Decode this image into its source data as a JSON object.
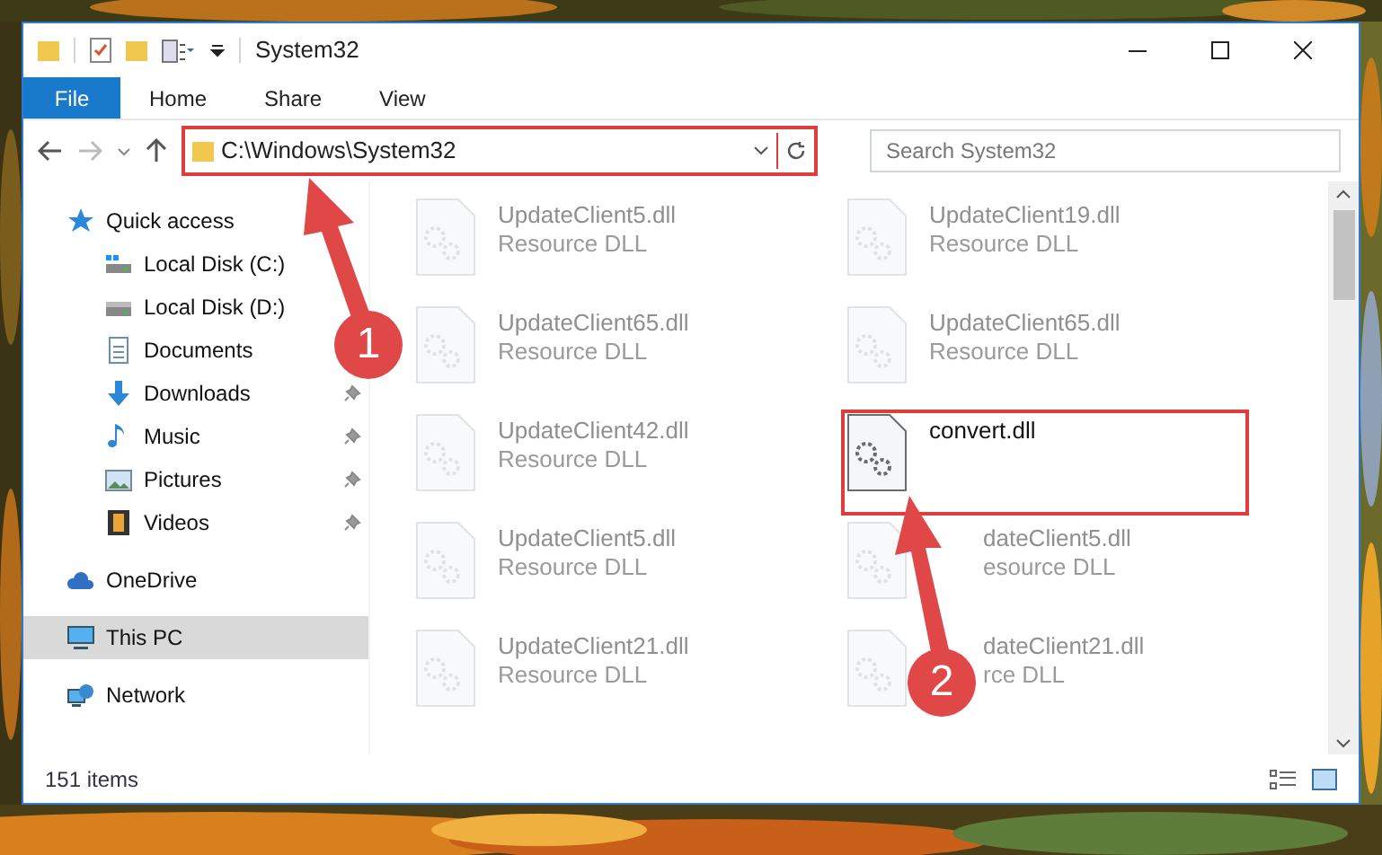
{
  "window": {
    "title": "System32"
  },
  "ribbon": {
    "file_menu": "File",
    "tabs": [
      "Home",
      "Share",
      "View"
    ]
  },
  "address": "C:\\Windows\\System32",
  "search": {
    "placeholder": "Search System32"
  },
  "sidebar": {
    "items": [
      {
        "label": "Quick access",
        "kind": "star",
        "selected": false,
        "children": [
          {
            "label": "Local Disk (C:)",
            "kind": "system-drive",
            "pinned": false
          },
          {
            "label": "Local Disk (D:)",
            "kind": "drive",
            "pinned": false
          },
          {
            "label": "Documents",
            "kind": "document",
            "pinned": false
          },
          {
            "label": "Downloads",
            "kind": "download",
            "pinned": true
          },
          {
            "label": "Music",
            "kind": "music",
            "pinned": true
          },
          {
            "label": "Pictures",
            "kind": "pictures",
            "pinned": true
          },
          {
            "label": "Videos",
            "kind": "videos",
            "pinned": true
          }
        ]
      },
      {
        "label": "OneDrive",
        "kind": "cloud",
        "selected": false
      },
      {
        "label": "This PC",
        "kind": "computer",
        "selected": true
      },
      {
        "label": "Network",
        "kind": "network",
        "selected": false
      }
    ]
  },
  "files": [
    {
      "name": "UpdateClient5.dll",
      "type": "Resource DLL",
      "highlighted": false
    },
    {
      "name": "UpdateClient19.dll",
      "type": "Resource DLL",
      "highlighted": false
    },
    {
      "name": "UpdateClient65.dll",
      "type": "Resource DLL",
      "highlighted": false
    },
    {
      "name": "UpdateClient65.dll",
      "type": "Resource DLL",
      "highlighted": false
    },
    {
      "name": "UpdateClient42.dll",
      "type": "Resource DLL",
      "highlighted": false
    },
    {
      "name": "convert.dll",
      "highlighted": true
    },
    {
      "name": "UpdateClient5.dll",
      "type": "Resource DLL",
      "highlighted": false
    },
    {
      "name": "dateClient5.dll",
      "type": "esource DLL",
      "highlighted": false
    },
    {
      "name": "UpdateClient21.dll",
      "type": "Resource DLL",
      "highlighted": false
    },
    {
      "name": "dateClient21.dll",
      "type": "rce DLL",
      "highlighted": false
    }
  ],
  "status_bar": "151 items",
  "annotations": [
    {
      "label": "1"
    },
    {
      "label": "2"
    }
  ]
}
